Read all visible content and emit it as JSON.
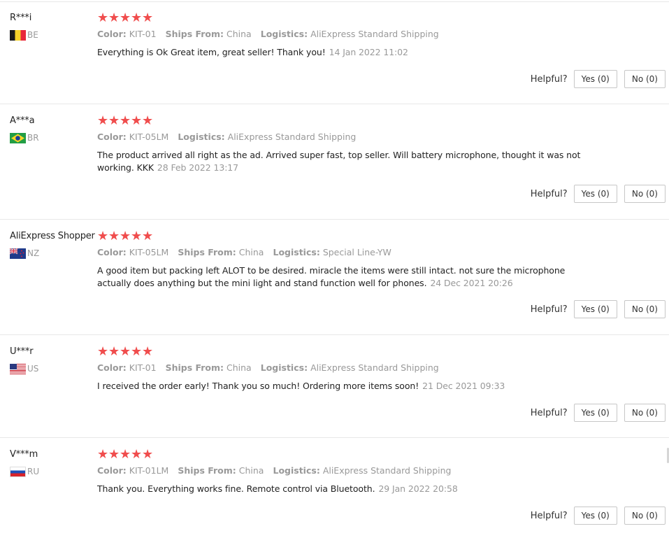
{
  "helpful_label": "Helpful?",
  "star_color": "#f04d4d",
  "reviews": [
    {
      "user": "R***i",
      "country": "BE",
      "flag": "belgium-flag",
      "rating": 5,
      "meta": [
        {
          "label": "Color:",
          "value": "KIT-01"
        },
        {
          "label": "Ships From:",
          "value": "China"
        },
        {
          "label": "Logistics:",
          "value": "AliExpress Standard Shipping"
        }
      ],
      "text": "Everything is Ok Great item, great seller! Thank you!",
      "date": "14 Jan 2022 11:02",
      "yes": "Yes (0)",
      "no": "No (0)"
    },
    {
      "user": "A***a",
      "country": "BR",
      "flag": "brazil-flag",
      "rating": 5,
      "meta": [
        {
          "label": "Color:",
          "value": "KIT-05LM"
        },
        {
          "label": "Logistics:",
          "value": "AliExpress Standard Shipping"
        }
      ],
      "text": "The product arrived all right as the ad. Arrived super fast, top seller. Will battery microphone, thought it was not working. KKK",
      "date": "28 Feb 2022 13:17",
      "yes": "Yes (0)",
      "no": "No (0)"
    },
    {
      "user": "AliExpress Shopper",
      "country": "NZ",
      "flag": "new-zealand-flag",
      "rating": 5,
      "meta": [
        {
          "label": "Color:",
          "value": "KIT-05LM"
        },
        {
          "label": "Ships From:",
          "value": "China"
        },
        {
          "label": "Logistics:",
          "value": "Special Line-YW"
        }
      ],
      "text": "A good item but packing left ALOT to be desired. miracle the items were still intact. not sure the microphone actually does anything but the mini light and stand function well for phones.",
      "date": "24 Dec 2021 20:26",
      "yes": "Yes (0)",
      "no": "No (0)"
    },
    {
      "user": "U***r",
      "country": "US",
      "flag": "usa-flag",
      "rating": 5,
      "meta": [
        {
          "label": "Color:",
          "value": "KIT-01"
        },
        {
          "label": "Ships From:",
          "value": "China"
        },
        {
          "label": "Logistics:",
          "value": "AliExpress Standard Shipping"
        }
      ],
      "text": "I received the order early! Thank you so much! Ordering more items soon!",
      "date": "21 Dec 2021 09:33",
      "yes": "Yes (0)",
      "no": "No (0)"
    },
    {
      "user": "V***m",
      "country": "RU",
      "flag": "russia-flag",
      "rating": 5,
      "meta": [
        {
          "label": "Color:",
          "value": "KIT-01LM"
        },
        {
          "label": "Ships From:",
          "value": "China"
        },
        {
          "label": "Logistics:",
          "value": "AliExpress Standard Shipping"
        }
      ],
      "text": "Thank you. Everything works fine. Remote control via Bluetooth.",
      "date": "29 Jan 2022 20:58",
      "yes": "Yes (0)",
      "no": "No (0)"
    }
  ]
}
